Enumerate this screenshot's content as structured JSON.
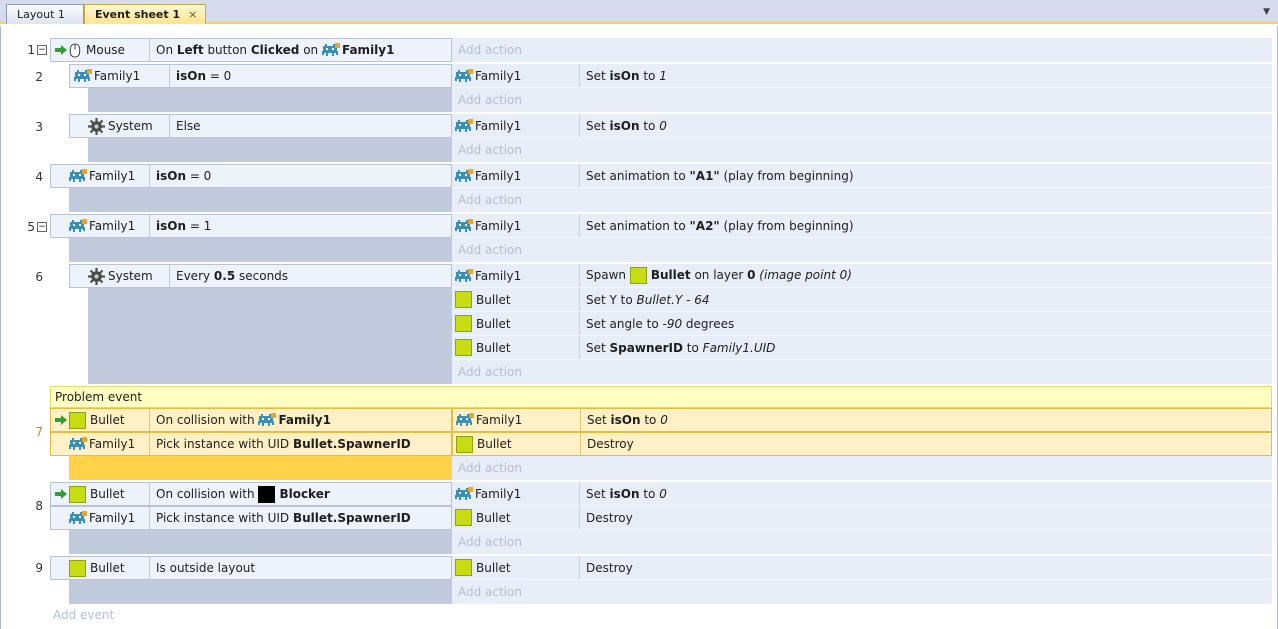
{
  "tabs": [
    {
      "label": "Layout 1"
    },
    {
      "label": "Event sheet 1",
      "close": "×"
    }
  ],
  "ui": {
    "add_action": "Add action",
    "add_event": "Add event",
    "dropdown": "▼"
  },
  "events": [
    {
      "num": "1",
      "cond": {
        "obj": "Mouse",
        "p1": "On ",
        "b1": "Left",
        "p2": " button ",
        "b2": "Clicked",
        "p3": " on ",
        "b3": "Family1"
      }
    },
    {
      "num": "2",
      "cond": {
        "obj": "Family1",
        "b1": "isOn",
        "p1": " = 0"
      },
      "act": {
        "obj": "Family1",
        "p1": "Set ",
        "b1": "isOn",
        "p2": " to ",
        "i1": "1"
      }
    },
    {
      "num": "3",
      "cond": {
        "obj": "System",
        "p1": "Else"
      },
      "act": {
        "obj": "Family1",
        "p1": "Set ",
        "b1": "isOn",
        "p2": " to ",
        "i1": "0"
      }
    },
    {
      "num": "4",
      "cond": {
        "obj": "Family1",
        "b1": "isOn",
        "p1": " = 0"
      },
      "act": {
        "obj": "Family1",
        "p1": "Set animation to ",
        "b1": "\"A1\"",
        "p2": " (play from beginning)"
      }
    },
    {
      "num": "5",
      "cond": {
        "obj": "Family1",
        "b1": "isOn",
        "p1": " = 1"
      },
      "act": {
        "obj": "Family1",
        "p1": "Set animation to ",
        "b1": "\"A2\"",
        "p2": " (play from beginning)"
      }
    },
    {
      "num": "6",
      "cond": {
        "obj": "System",
        "p1": "Every ",
        "b1": "0.5",
        "p2": " seconds"
      },
      "acts": [
        {
          "obj": "Family1",
          "p1": "Spawn ",
          "b1": "Bullet",
          "p2": " on layer ",
          "b2": "0",
          "i1": " (image point 0)"
        },
        {
          "obj": "Bullet",
          "p1": "Set Y to ",
          "i1": "Bullet.Y - 64"
        },
        {
          "obj": "Bullet",
          "p1": "Set angle to ",
          "i1": "-90",
          "p2": " degrees"
        },
        {
          "obj": "Bullet",
          "p1": "Set ",
          "b1": "SpawnerID",
          "p2": " to ",
          "i1": "Family1.UID"
        }
      ]
    },
    {
      "num": "7",
      "comment": "Problem event",
      "conds": [
        {
          "obj": "Bullet",
          "p1": "On collision with ",
          "b1": "Family1"
        },
        {
          "obj": "Family1",
          "p1": "Pick instance with UID ",
          "b1": "Bullet.SpawnerID"
        }
      ],
      "acts": [
        {
          "obj": "Family1",
          "p1": "Set ",
          "b1": "isOn",
          "p2": " to ",
          "i1": "0"
        },
        {
          "obj": "Bullet",
          "p1": "Destroy"
        }
      ]
    },
    {
      "num": "8",
      "conds": [
        {
          "obj": "Bullet",
          "p1": "On collision with ",
          "b1": "Blocker"
        },
        {
          "obj": "Family1",
          "p1": "Pick instance with UID ",
          "b1": "Bullet.SpawnerID"
        }
      ],
      "acts": [
        {
          "obj": "Family1",
          "p1": "Set ",
          "b1": "isOn",
          "p2": " to ",
          "i1": "0"
        },
        {
          "obj": "Bullet",
          "p1": "Destroy"
        }
      ]
    },
    {
      "num": "9",
      "cond": {
        "obj": "Bullet",
        "p1": "Is outside layout"
      },
      "act": {
        "obj": "Bullet",
        "p1": "Destroy"
      }
    }
  ],
  "colors": {
    "bullet": "#c5dd12",
    "blocker": "#000000",
    "highlight": "#fff1c5",
    "comment": "#ffffc2"
  },
  "icons": {
    "family": "family-sprite-icon",
    "bullet": "bullet-green-square-icon",
    "system": "gear-icon",
    "mouse": "mouse-icon",
    "trigger": "trigger-arrow-icon",
    "blocker": "blocker-black-square-icon"
  }
}
